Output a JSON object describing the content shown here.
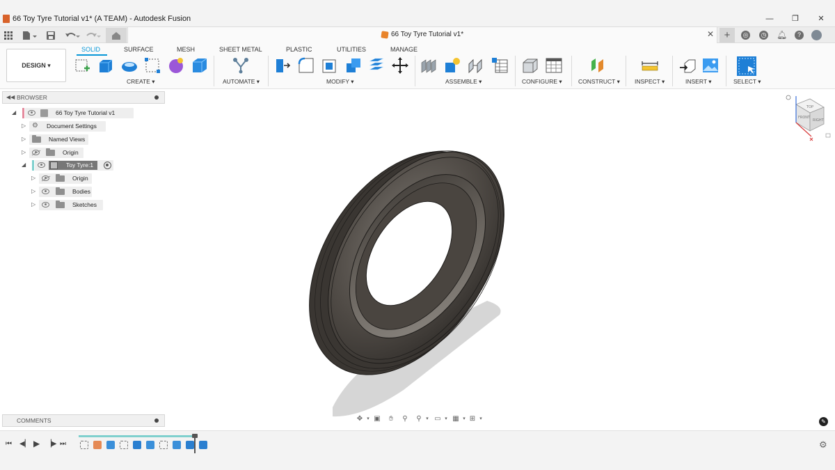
{
  "window": {
    "title": "66 Toy Tyre Tutorial v1* (A TEAM) - Autodesk Fusion",
    "minimize_glyph": "—",
    "restore_glyph": "❐",
    "close_glyph": "✕"
  },
  "tabbar": {
    "document_tab_title": "66 Toy Tyre Tutorial v1*",
    "close_glyph": "✕",
    "new_tab_glyph": "+"
  },
  "ribbon": {
    "workspace_button": "DESIGN ▾",
    "tabs": [
      "SOLID",
      "SURFACE",
      "MESH",
      "SHEET METAL",
      "PLASTIC",
      "UTILITIES",
      "MANAGE"
    ],
    "active_tab": "SOLID",
    "groups": {
      "create": "CREATE ▾",
      "automate": "AUTOMATE ▾",
      "modify": "MODIFY ▾",
      "assemble": "ASSEMBLE ▾",
      "configure": "CONFIGURE ▾",
      "construct": "CONSTRUCT ▾",
      "inspect": "INSPECT ▾",
      "insert": "INSERT ▾",
      "select": "SELECT ▾"
    },
    "accent_color": "#0696d7"
  },
  "browser": {
    "title": "BROWSER",
    "root": "66 Toy Tyre Tutorial v1",
    "items": {
      "document_settings": "Document Settings",
      "named_views": "Named Views",
      "origin": "Origin",
      "component": "Toy Tyre:1",
      "component_origin": "Origin",
      "bodies": "Bodies",
      "sketches": "Sketches"
    }
  },
  "comments": {
    "title": "COMMENTS"
  },
  "viewcube": {
    "faces": [
      "TOP",
      "FRONT",
      "RIGHT"
    ]
  },
  "timeline": {
    "features": [
      "sketch",
      "revolve",
      "fillet",
      "sketch",
      "extrude",
      "fillet",
      "sketch",
      "fillet",
      "extrude",
      "extrude"
    ]
  }
}
